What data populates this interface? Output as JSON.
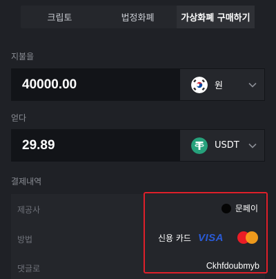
{
  "tabs": [
    "크립토",
    "법정화폐",
    "가상화폐 구매하기"
  ],
  "pay": {
    "label": "지불을",
    "amount": "40000.00",
    "currency": "원",
    "currency_icon": "south-korea-flag-icon"
  },
  "receive": {
    "label": "얻다",
    "amount": "29.89",
    "currency": "USDT",
    "currency_icon": "tether-icon",
    "icon_color": "#26a17b"
  },
  "details": {
    "title": "결제내역",
    "provider_label": "제공사",
    "provider_value": "문페이",
    "method_label": "방법",
    "method_value": "신용 카드",
    "visa_text": "VISA",
    "comment_label": "댓글로",
    "comment_value": "Ckhfdoubmyb"
  },
  "colors": {
    "background": "#1f2126",
    "input_bg": "#121418",
    "highlight_border": "#e0202a"
  }
}
